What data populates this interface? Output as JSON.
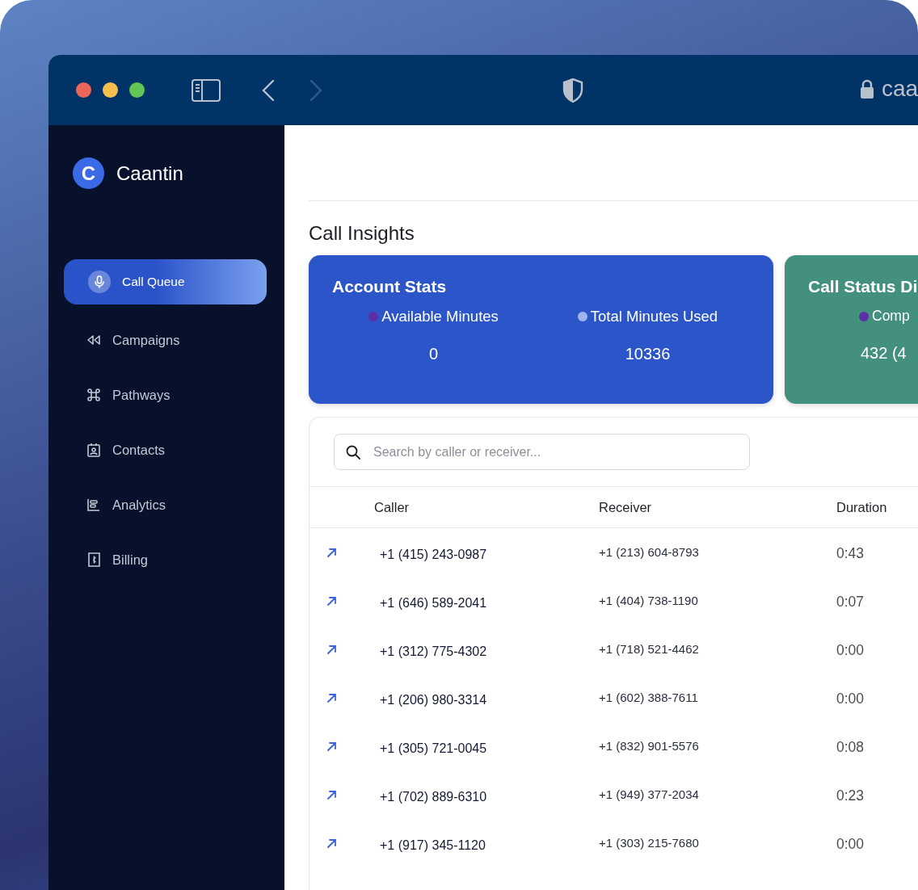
{
  "browser": {
    "address": "caa"
  },
  "sidebar": {
    "logo_letter": "C",
    "brand": "Caantin",
    "items": [
      {
        "label": "Call Queue",
        "selected": true
      },
      {
        "label": "Campaigns",
        "selected": false
      },
      {
        "label": "Pathways",
        "selected": false
      },
      {
        "label": "Contacts",
        "selected": false
      },
      {
        "label": "Analytics",
        "selected": false
      },
      {
        "label": "Billing",
        "selected": false
      }
    ]
  },
  "main": {
    "title": "Call Insights",
    "cards": [
      {
        "title": "Account Stats",
        "color": "#2b55c9",
        "stats": [
          {
            "label": "Available Minutes",
            "color": "#5b2fa8",
            "value": "0"
          },
          {
            "label": "Total Minutes Used",
            "color": "#9db4ee",
            "value": "10336"
          }
        ]
      },
      {
        "title": "Call Status Di",
        "color": "#44907f",
        "stats": [
          {
            "label": "Comp",
            "color": "#5b2fa8",
            "value": "432 (4"
          }
        ]
      }
    ]
  },
  "calls": {
    "search": {
      "placeholder": "Search by caller or receiver..."
    },
    "columns": [
      "Caller",
      "Receiver",
      "Duration"
    ],
    "rows": [
      {
        "caller": "+1 (415) 243-0987",
        "receiver": "+1 (213) 604-8793",
        "duration": "0:43"
      },
      {
        "caller": "+1 (646) 589-2041",
        "receiver": "+1 (404) 738-1190",
        "duration": "0:07"
      },
      {
        "caller": "+1 (312) 775-4302",
        "receiver": "+1 (718) 521-4462",
        "duration": "0:00"
      },
      {
        "caller": "+1 (206) 980-3314",
        "receiver": "+1 (602) 388-7611",
        "duration": "0:00"
      },
      {
        "caller": "+1 (305) 721-0045",
        "receiver": "+1 (832) 901-5576",
        "duration": "0:08"
      },
      {
        "caller": "+1 (702) 889-6310",
        "receiver": "+1 (949) 377-2034",
        "duration": "0:23"
      },
      {
        "caller": "+1 (917) 345-1120",
        "receiver": "+1 (303) 215-7680",
        "duration": "0:00"
      }
    ]
  }
}
